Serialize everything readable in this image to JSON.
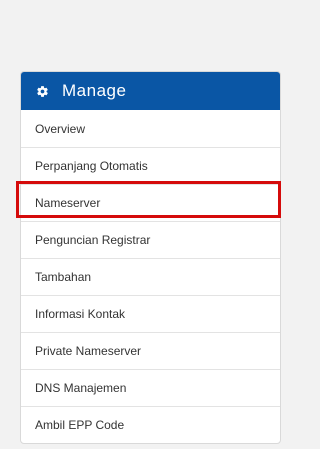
{
  "panel": {
    "title": "Manage",
    "icon": "gear-icon",
    "header_color": "#0a56a5",
    "highlight_color": "#d50b0b"
  },
  "menu": {
    "items": [
      {
        "label": "Overview"
      },
      {
        "label": "Perpanjang Otomatis"
      },
      {
        "label": "Nameserver",
        "highlighted": true
      },
      {
        "label": "Penguncian Registrar"
      },
      {
        "label": "Tambahan"
      },
      {
        "label": "Informasi Kontak"
      },
      {
        "label": "Private Nameserver"
      },
      {
        "label": "DNS Manajemen"
      },
      {
        "label": "Ambil EPP Code"
      }
    ]
  }
}
